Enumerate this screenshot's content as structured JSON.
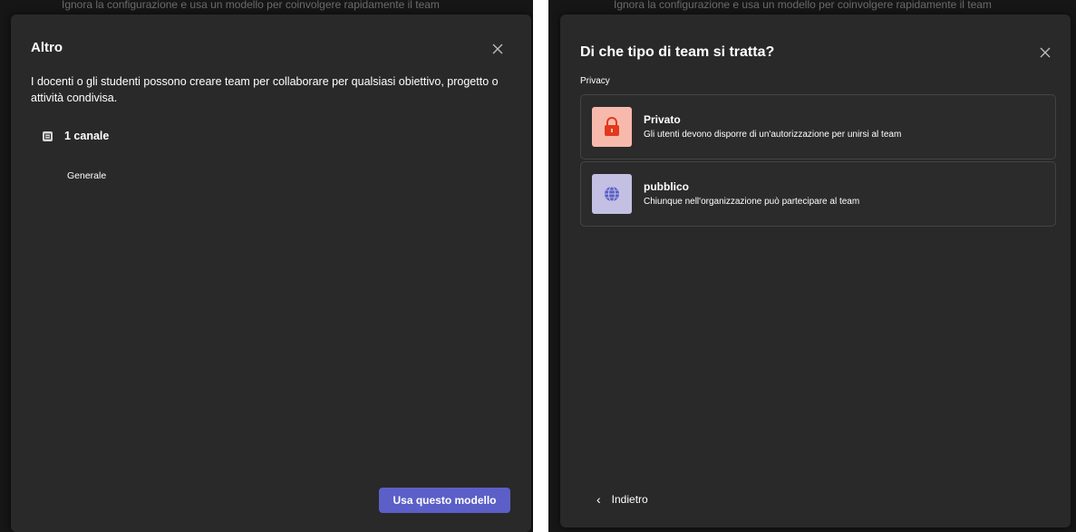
{
  "left_panel": {
    "background_text": "Ignora la configurazione e usa un modello per coinvolgere rapidamente il team",
    "title": "Altro",
    "close_icon": "close-icon",
    "description": "I docenti o gli studenti possono creare team per collaborare per qualsiasi obiettivo, progetto o attività condivisa.",
    "channel_icon": "channel-icon",
    "channel_count": "1 canale",
    "channel_name": "Generale",
    "use_template_label": "Usa questo modello"
  },
  "right_panel": {
    "background_text": "Ignora la configurazione e usa un modello per coinvolgere rapidamente il team",
    "title": "Di che tipo di team si tratta?",
    "close_icon": "close-icon",
    "privacy_label": "Privacy",
    "options": [
      {
        "icon": "lock-icon",
        "title": "Privato",
        "description": "Gli utenti devono disporre di un'autorizzazione per unirsi al team",
        "icon_bg": "#f7b9ac"
      },
      {
        "icon": "globe-icon",
        "title": "pubblico",
        "description": "Chiunque nell'organizzazione può partecipare al team",
        "icon_bg": "#c3c0e3"
      }
    ],
    "back_icon": "chevron-left-icon",
    "back_label": "Indietro"
  },
  "colors": {
    "dialog_bg": "#292929",
    "backdrop": "#161616",
    "accent": "#5b5fc7",
    "card_border": "#444444"
  }
}
